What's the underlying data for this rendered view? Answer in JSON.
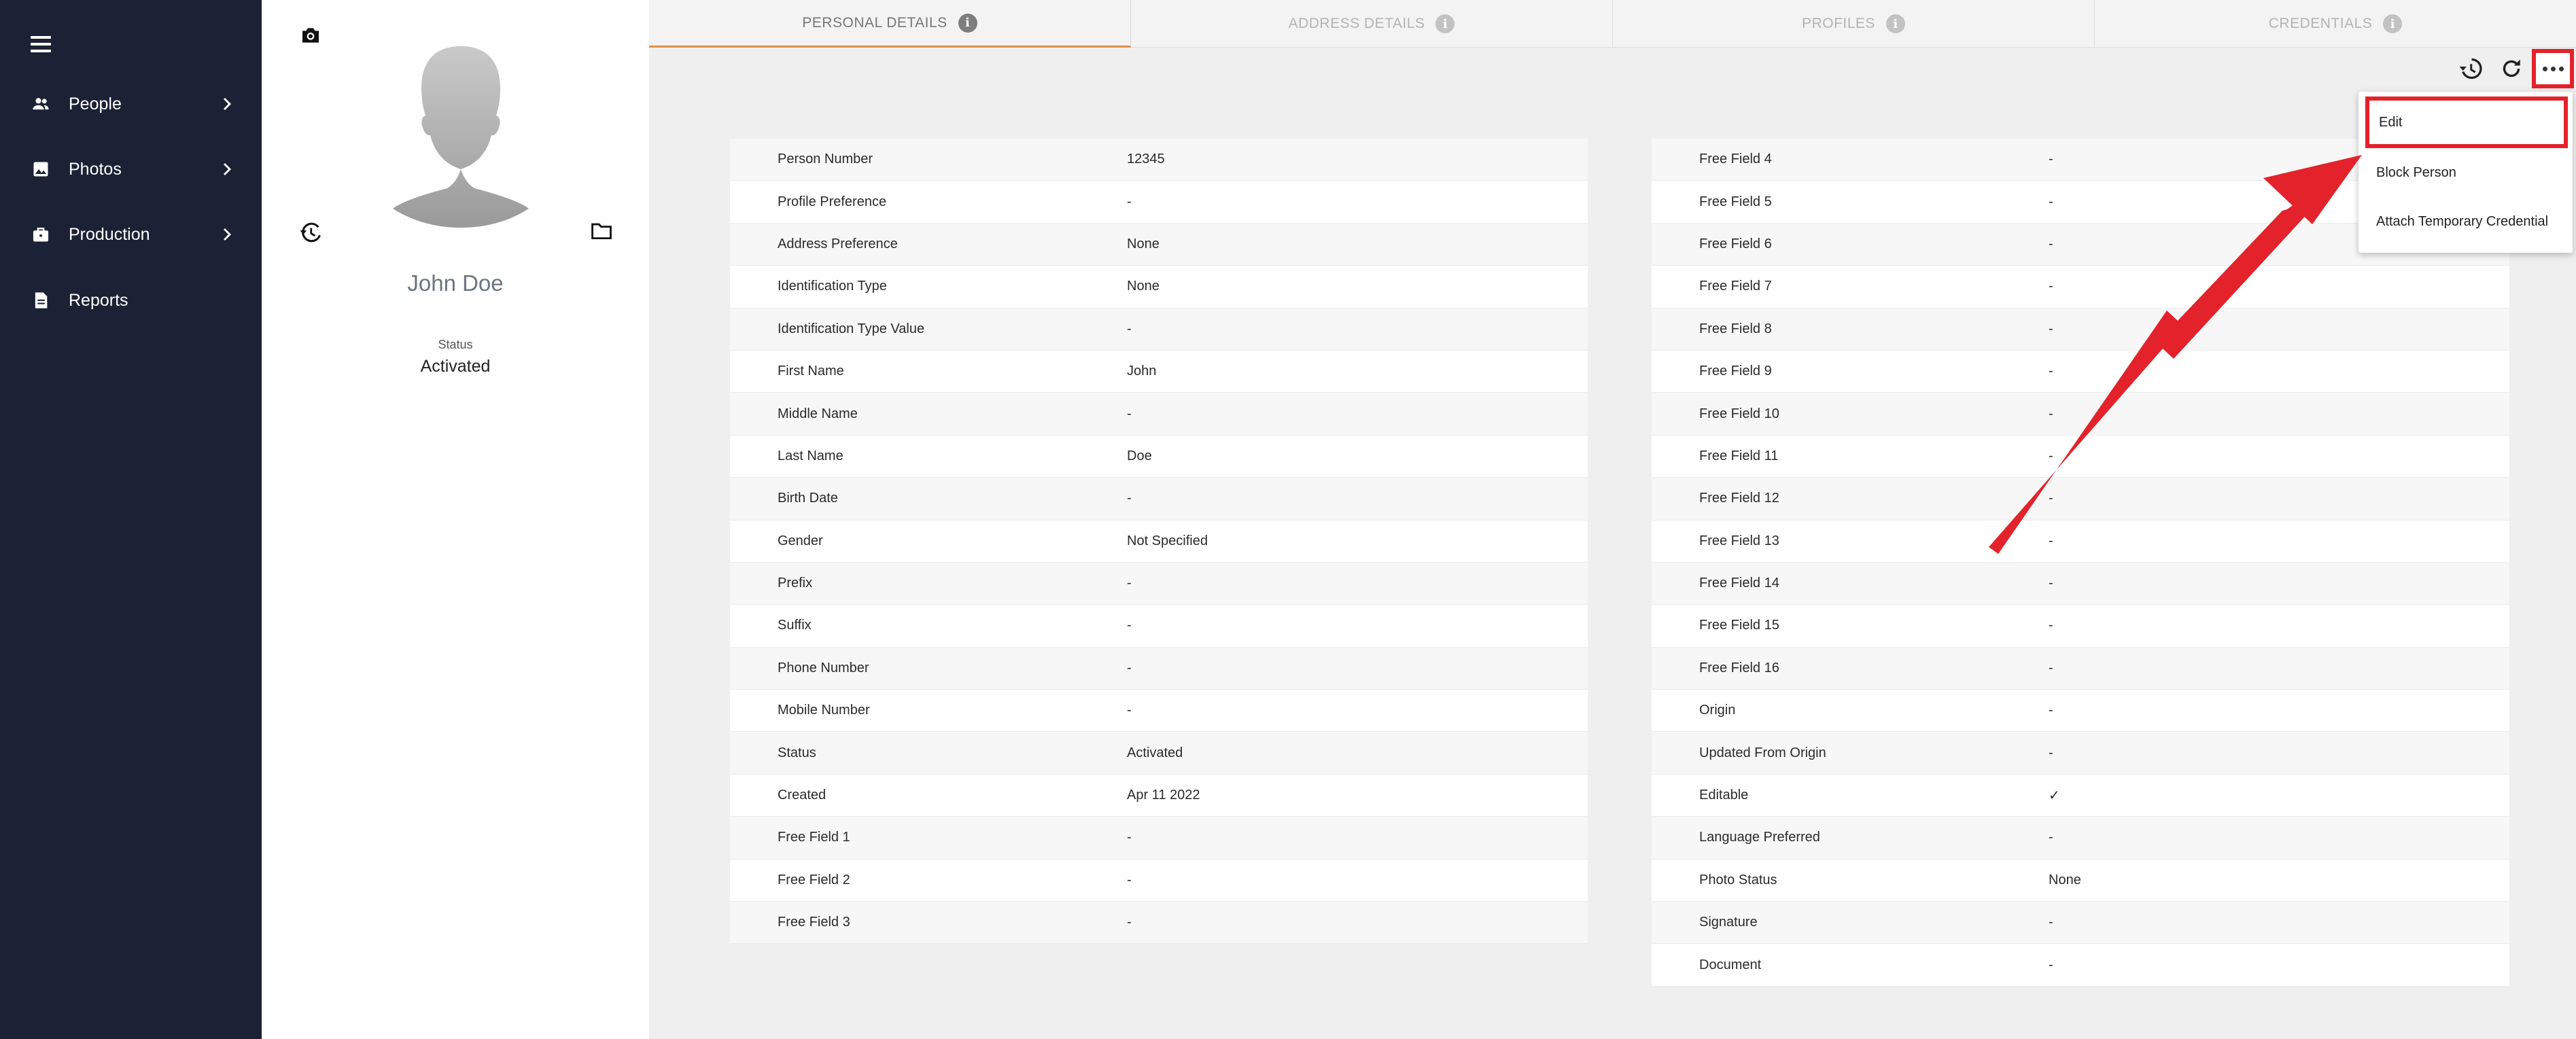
{
  "sidebar": {
    "items": [
      {
        "label": "People",
        "icon": "people-icon",
        "has_chevron": true
      },
      {
        "label": "Photos",
        "icon": "photo-icon",
        "has_chevron": true
      },
      {
        "label": "Production",
        "icon": "briefcase-icon",
        "has_chevron": true
      },
      {
        "label": "Reports",
        "icon": "document-icon",
        "has_chevron": false
      }
    ]
  },
  "profile": {
    "name": "John Doe",
    "status_label": "Status",
    "status_value": "Activated"
  },
  "tabs": [
    {
      "label": "PERSONAL DETAILS",
      "active": true
    },
    {
      "label": "ADDRESS DETAILS",
      "active": false
    },
    {
      "label": "PROFILES",
      "active": false
    },
    {
      "label": "CREDENTIALS",
      "active": false
    }
  ],
  "details_left": [
    {
      "key": "Person Number",
      "value": "12345"
    },
    {
      "key": "Profile Preference",
      "value": "-"
    },
    {
      "key": "Address Preference",
      "value": "None"
    },
    {
      "key": "Identification Type",
      "value": "None"
    },
    {
      "key": "Identification Type Value",
      "value": "-"
    },
    {
      "key": "First Name",
      "value": "John"
    },
    {
      "key": "Middle Name",
      "value": "-"
    },
    {
      "key": "Last Name",
      "value": "Doe"
    },
    {
      "key": "Birth Date",
      "value": "-"
    },
    {
      "key": "Gender",
      "value": "Not Specified"
    },
    {
      "key": "Prefix",
      "value": "-"
    },
    {
      "key": "Suffix",
      "value": "-"
    },
    {
      "key": "Phone Number",
      "value": "-"
    },
    {
      "key": "Mobile Number",
      "value": "-"
    },
    {
      "key": "Status",
      "value": "Activated"
    },
    {
      "key": "Created",
      "value": "Apr 11 2022"
    },
    {
      "key": "Free Field 1",
      "value": "-"
    },
    {
      "key": "Free Field 2",
      "value": "-"
    },
    {
      "key": "Free Field 3",
      "value": "-"
    }
  ],
  "details_right": [
    {
      "key": "Free Field 4",
      "value": "-"
    },
    {
      "key": "Free Field 5",
      "value": "-"
    },
    {
      "key": "Free Field 6",
      "value": "-"
    },
    {
      "key": "Free Field 7",
      "value": "-"
    },
    {
      "key": "Free Field 8",
      "value": "-"
    },
    {
      "key": "Free Field 9",
      "value": "-"
    },
    {
      "key": "Free Field 10",
      "value": "-"
    },
    {
      "key": "Free Field 11",
      "value": "-"
    },
    {
      "key": "Free Field 12",
      "value": "-"
    },
    {
      "key": "Free Field 13",
      "value": "-"
    },
    {
      "key": "Free Field 14",
      "value": "-"
    },
    {
      "key": "Free Field 15",
      "value": "-"
    },
    {
      "key": "Free Field 16",
      "value": "-"
    },
    {
      "key": "Origin",
      "value": "-"
    },
    {
      "key": "Updated From Origin",
      "value": "-"
    },
    {
      "key": "Editable",
      "value": "✓"
    },
    {
      "key": "Language Preferred",
      "value": "-"
    },
    {
      "key": "Photo Status",
      "value": "None"
    },
    {
      "key": "Signature",
      "value": "-"
    },
    {
      "key": "Document",
      "value": "-"
    }
  ],
  "menu": {
    "items": [
      {
        "label": "Edit",
        "highlighted": true
      },
      {
        "label": "Block Person",
        "highlighted": false
      },
      {
        "label": "Attach Temporary Credential",
        "highlighted": false
      }
    ]
  },
  "colors": {
    "sidebar_bg": "#1b2235",
    "active_tab_underline": "#e0914a",
    "annotation_red": "#e3222b"
  }
}
